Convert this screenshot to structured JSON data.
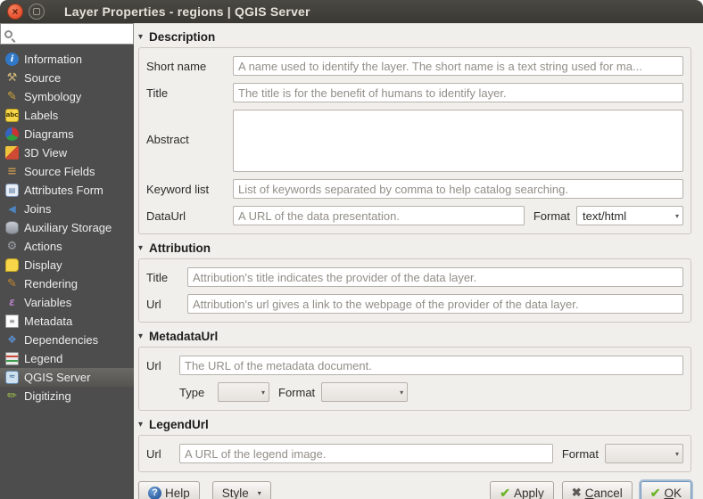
{
  "window": {
    "title": "Layer Properties - regions | QGIS Server"
  },
  "icons": {
    "close": "×",
    "collapse": "▾",
    "chevron": "▾",
    "check": "✔",
    "cross": "✖",
    "question": "?",
    "info": "i",
    "source": "⚒",
    "symbology": "✎",
    "labels": "abc",
    "fields": "≡",
    "form": "▤",
    "joins": "◀",
    "actions": "⚙",
    "rendering": "✎",
    "variables": "ε",
    "metadata": "≡",
    "dependencies": "❖",
    "server": "≈",
    "digitizing": "✏"
  },
  "sidebar": {
    "search_placeholder": "",
    "items": [
      {
        "label": "Information",
        "icon": "info"
      },
      {
        "label": "Source",
        "icon": "source"
      },
      {
        "label": "Symbology",
        "icon": "symbology"
      },
      {
        "label": "Labels",
        "icon": "labels"
      },
      {
        "label": "Diagrams",
        "icon": "diagrams"
      },
      {
        "label": "3D View",
        "icon": "3dview"
      },
      {
        "label": "Source Fields",
        "icon": "fields"
      },
      {
        "label": "Attributes Form",
        "icon": "form"
      },
      {
        "label": "Joins",
        "icon": "joins"
      },
      {
        "label": "Auxiliary Storage",
        "icon": "storage"
      },
      {
        "label": "Actions",
        "icon": "actions"
      },
      {
        "label": "Display",
        "icon": "display"
      },
      {
        "label": "Rendering",
        "icon": "rendering"
      },
      {
        "label": "Variables",
        "icon": "variables"
      },
      {
        "label": "Metadata",
        "icon": "metadata"
      },
      {
        "label": "Dependencies",
        "icon": "dependencies"
      },
      {
        "label": "Legend",
        "icon": "legend"
      },
      {
        "label": "QGIS Server",
        "icon": "server"
      },
      {
        "label": "Digitizing",
        "icon": "digitizing"
      }
    ],
    "selected": "QGIS Server"
  },
  "description": {
    "title": "Description",
    "short_name_label": "Short name",
    "short_name_placeholder": "A name used to identify the layer. The short name is a text string used for ma...",
    "title_label": "Title",
    "title_placeholder": "The title is for the benefit of humans to identify layer.",
    "abstract_label": "Abstract",
    "keyword_label": "Keyword list",
    "keyword_placeholder": "List of keywords separated by comma to help catalog searching.",
    "dataurl_label": "DataUrl",
    "dataurl_placeholder": "A URL of the data presentation.",
    "format_label": "Format",
    "format_value": "text/html"
  },
  "attribution": {
    "title": "Attribution",
    "title_label": "Title",
    "title_placeholder": "Attribution's title indicates the provider of the data layer.",
    "url_label": "Url",
    "url_placeholder": "Attribution's url gives a link to the webpage of the provider of the data layer."
  },
  "metadataurl": {
    "title": "MetadataUrl",
    "url_label": "Url",
    "url_placeholder": "The URL of the metadata document.",
    "type_label": "Type",
    "type_value": "",
    "format_label": "Format",
    "format_value": ""
  },
  "legendurl": {
    "title": "LegendUrl",
    "url_label": "Url",
    "url_placeholder": "A URL of the legend image.",
    "format_label": "Format",
    "format_value": ""
  },
  "footer": {
    "help": "Help",
    "style": "Style",
    "apply": "Apply",
    "cancel_initial": "C",
    "cancel_rest": "ancel",
    "ok_initial": "O",
    "ok_rest": "K"
  }
}
